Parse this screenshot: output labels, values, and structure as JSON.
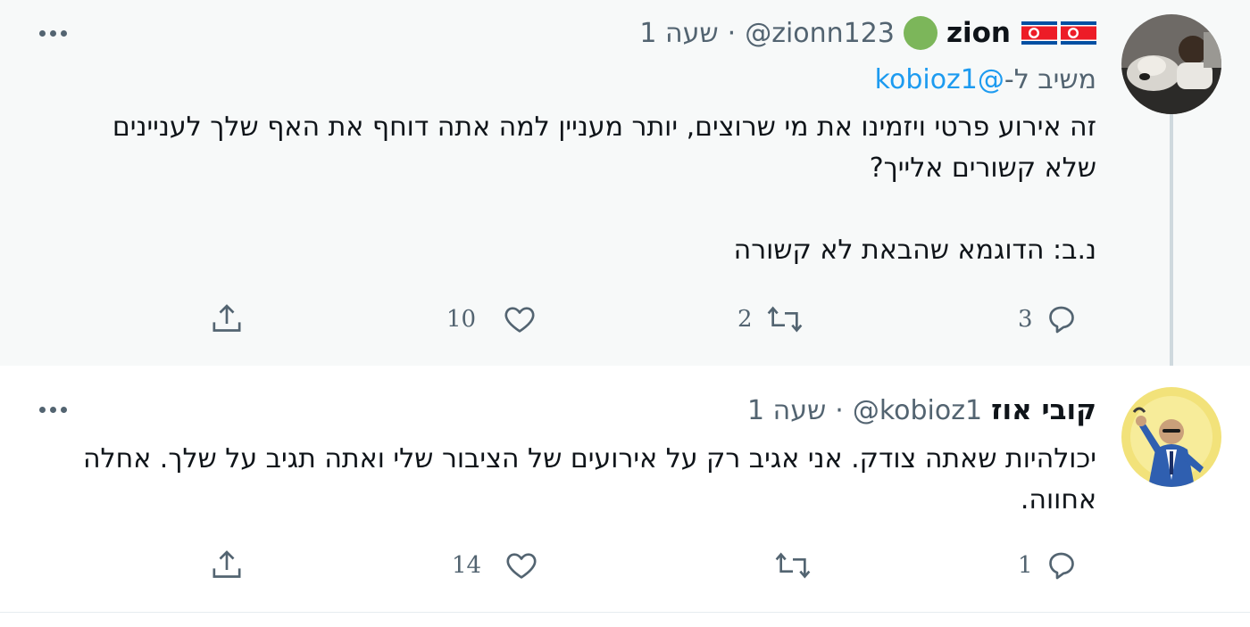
{
  "tweets": [
    {
      "display_name": "zion",
      "handle": "@zionn123",
      "separator": "·",
      "time": "שעה 1",
      "reply_to": {
        "prefix": "משיב ל-",
        "mention": "@kobioz1"
      },
      "body": [
        "זה אירוע פרטי ויזמינו את מי שרוצים, יותר מעניין למה אתה דוחף את האף שלך לעניינים שלא קשורים אלייך?",
        "נ.ב: הדוגמא שהבאת לא קשורה"
      ],
      "actions": {
        "reply_count": "3",
        "retweet_count": "2",
        "like_count": "10",
        "share_count": ""
      },
      "flags": [
        "north-korea-flag",
        "north-korea-flag"
      ]
    },
    {
      "display_name": "קובי אוז",
      "handle": "@kobioz1",
      "separator": "·",
      "time": "שעה 1",
      "body": [
        "יכולהיות שאתה צודק. אני אגיב רק על אירועים של הציבור שלי ואתה תגיב על שלך. אחלה אחווה."
      ],
      "actions": {
        "reply_count": "1",
        "retweet_count": "",
        "like_count": "14",
        "share_count": ""
      }
    }
  ],
  "icons": {
    "more": "more-horizontal-icon",
    "reply": "reply-bubble-icon",
    "retweet": "retweet-icon",
    "like": "heart-icon",
    "share": "share-upload-icon"
  },
  "colors": {
    "link": "#1d9bf0",
    "secondary_text": "#536471",
    "thread_line": "#cfd9de",
    "highlight_bg": "#f7f9f9"
  }
}
